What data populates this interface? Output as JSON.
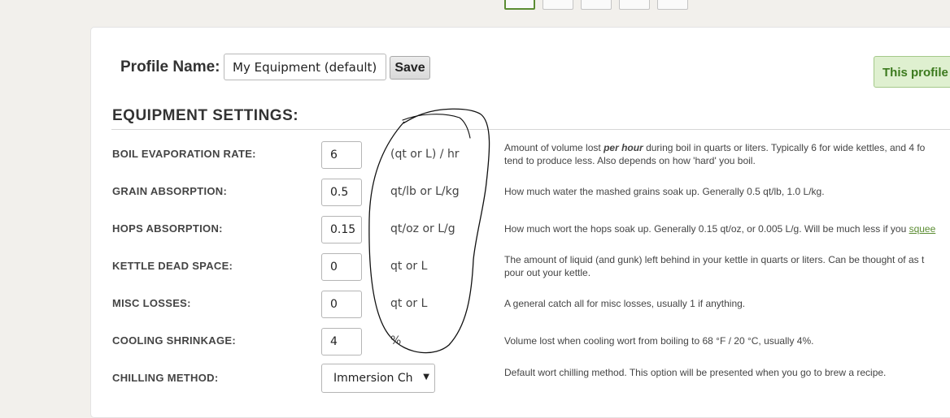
{
  "pager": {
    "pages": [
      "",
      "",
      "",
      "",
      ""
    ]
  },
  "profile": {
    "label": "Profile Name:",
    "value": "My Equipment (default)",
    "save_label": "Save",
    "status_note": "This profile"
  },
  "section": {
    "title": "EQUIPMENT SETTINGS:"
  },
  "rows": [
    {
      "label": "BOIL EVAPORATION RATE:",
      "value": "6",
      "unit": "(qt or L) / hr",
      "desc_pre": "Amount of volume lost ",
      "desc_em": "per hour",
      "desc_post": " during boil in quarts or liters. Typically 6 for wide kettles, and 4 fo",
      "desc_line2": "tend to produce less. Also depends on how 'hard' you boil."
    },
    {
      "label": "GRAIN ABSORPTION:",
      "value": "0.5",
      "unit": "qt/lb or L/kg",
      "desc": "How much water the mashed grains soak up. Generally 0.5 qt/lb, 1.0 L/kg."
    },
    {
      "label": "HOPS ABSORPTION:",
      "value": "0.15",
      "unit": "qt/oz or L/g",
      "desc": "How much wort the hops soak up. Generally 0.15 qt/oz, or 0.005 L/g. Will be much less if you ",
      "desc_link": "squee"
    },
    {
      "label": "KETTLE DEAD SPACE:",
      "value": "0",
      "unit": "qt or L",
      "desc": "The amount of liquid (and gunk) left behind in your kettle in quarts or liters. Can be thought of as t",
      "desc_line2": "pour out your kettle."
    },
    {
      "label": "MISC LOSSES:",
      "value": "0",
      "unit": "qt or L",
      "desc": "A general catch all for misc losses, usually 1 if anything."
    },
    {
      "label": "COOLING SHRINKAGE:",
      "value": "4",
      "unit": "%",
      "desc": "Volume lost when cooling wort from boiling to 68 °F / 20 °C, usually 4%."
    },
    {
      "label": "CHILLING METHOD:",
      "selected": "Immersion Chiller",
      "desc": "Default wort chilling method. This option will be presented when you go to brew a recipe."
    }
  ],
  "colors": {
    "accent": "#5b8c32",
    "note_bg": "#dff0d0",
    "annotation": "#111111"
  }
}
